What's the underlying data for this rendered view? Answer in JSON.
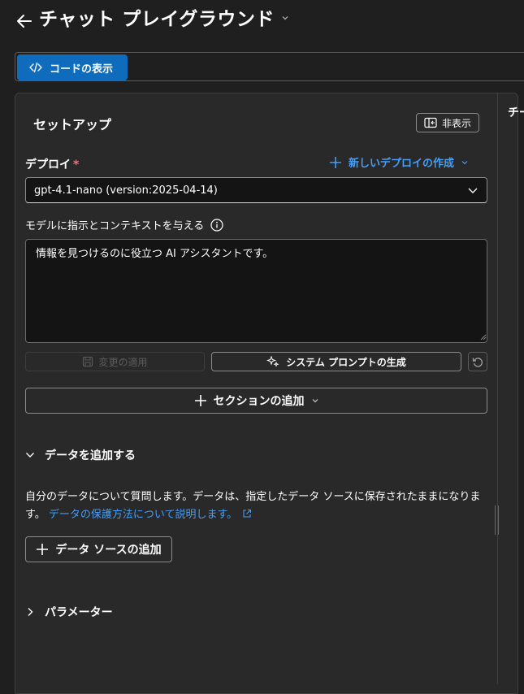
{
  "header": {
    "title": "チャット プレイグラウンド",
    "back_icon": "arrow-left-icon",
    "title_chevron_icon": "chevron-down-icon"
  },
  "toolbar": {
    "code_button_label": "コードの表示",
    "code_icon": "code-icon",
    "accent_color": "#0f6cbd"
  },
  "right_panel": {
    "title_partial": "チー"
  },
  "setup": {
    "title": "セットアップ",
    "hide_button_label": "非表示",
    "deploy": {
      "label": "デプロイ",
      "required_mark": "*",
      "new_deploy_label": "新しいデプロイの作成",
      "selected_model": "gpt-4.1-nano (version:2025-04-14)"
    },
    "instructions": {
      "label": "モデルに指示とコンテキストを与える",
      "value": "情報を見つけるのに役立つ AI アシスタントです。"
    },
    "apply_button_label": "変更の適用",
    "generate_prompt_label": "システム プロンプトの生成",
    "add_section_label": "セクションの追加"
  },
  "data_section": {
    "header": "データを追加する",
    "description": "自分のデータについて質問します。データは、指定したデータ ソースに保存されたままになります。",
    "link_text": "データの保護方法について説明します。",
    "add_source_label": "データ ソースの追加"
  },
  "parameters": {
    "header": "パラメーター"
  },
  "colors": {
    "link": "#479ef5",
    "required": "#f1707b",
    "panel_bg": "#292929",
    "page_bg": "#1f1f1f"
  }
}
